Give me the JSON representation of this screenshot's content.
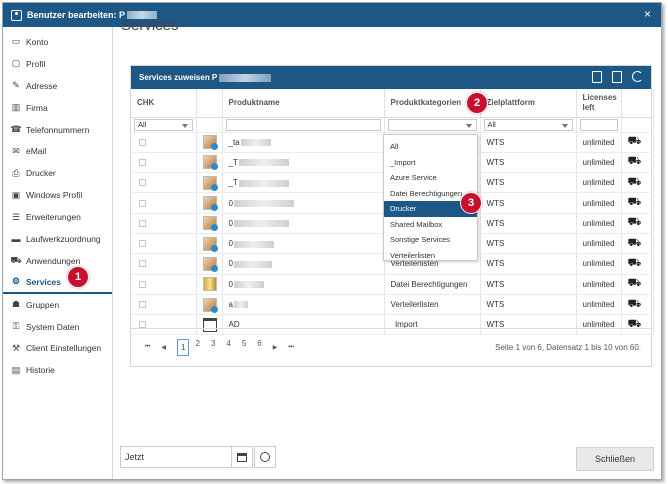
{
  "window": {
    "title": "Benutzer bearbeiten: P",
    "close_glyph": "×"
  },
  "sidebar": {
    "items": [
      {
        "label": "Konto",
        "icon": "card-icon"
      },
      {
        "label": "Profil",
        "icon": "profile-icon"
      },
      {
        "label": "Adresse",
        "icon": "edit-icon"
      },
      {
        "label": "Firma",
        "icon": "building-icon"
      },
      {
        "label": "Telefonnummern",
        "icon": "phone-icon"
      },
      {
        "label": "eMail",
        "icon": "mail-icon"
      },
      {
        "label": "Drucker",
        "icon": "printer-icon"
      },
      {
        "label": "Windows Profil",
        "icon": "window-icon"
      },
      {
        "label": "Erweiterungen",
        "icon": "list-icon"
      },
      {
        "label": "Laufwerkzuordnung",
        "icon": "drive-icon"
      },
      {
        "label": "Anwendungen",
        "icon": "cart-icon"
      },
      {
        "label": "Services",
        "icon": "gear-icon"
      },
      {
        "label": "Gruppen",
        "icon": "group-icon"
      },
      {
        "label": "System Daten",
        "icon": "key-icon"
      },
      {
        "label": "Client Einstellungen",
        "icon": "wrench-icon"
      },
      {
        "label": "Historie",
        "icon": "history-icon"
      }
    ]
  },
  "main": {
    "title": "Services"
  },
  "panel": {
    "title": "Services zuweisen P",
    "columns": [
      "CHK",
      "",
      "Produktname",
      "Produktkategorien",
      "Zielplattform",
      "Licenses left",
      ""
    ],
    "filters": {
      "chk": "All",
      "platform": "All"
    },
    "rows": [
      {
        "name": "_ta",
        "category": "",
        "platform": "WTS",
        "licenses": "unlimited",
        "icon": "service"
      },
      {
        "name": "_T",
        "category": "",
        "platform": "WTS",
        "licenses": "unlimited",
        "icon": "service"
      },
      {
        "name": "_T",
        "category": "",
        "platform": "WTS",
        "licenses": "unlimited",
        "icon": "service"
      },
      {
        "name": "0",
        "category": "",
        "platform": "WTS",
        "licenses": "unlimited",
        "icon": "service"
      },
      {
        "name": "0",
        "category": "",
        "platform": "WTS",
        "licenses": "unlimited",
        "icon": "service"
      },
      {
        "name": "0",
        "category": "",
        "platform": "WTS",
        "licenses": "unlimited",
        "icon": "service"
      },
      {
        "name": "0",
        "category": "Verteilerlisten",
        "platform": "WTS",
        "licenses": "unlimited",
        "icon": "service"
      },
      {
        "name": "0",
        "category": "Datei Berechtigungen",
        "platform": "WTS",
        "licenses": "unlimited",
        "icon": "jar"
      },
      {
        "name": "a",
        "category": "Verteilerlisten",
        "platform": "WTS",
        "licenses": "unlimited",
        "icon": "service"
      },
      {
        "name": "AD",
        "category": "_Import",
        "platform": "WTS",
        "licenses": "unlimited",
        "icon": "window"
      }
    ],
    "dropdown": {
      "options": [
        "All",
        "_Import",
        "Azure Service",
        "Datei Berechtigungen",
        "Drucker",
        "Shared Mailbox",
        "Sonstige Services",
        "Verteilerlisten"
      ],
      "selected": "Drucker"
    },
    "pager": {
      "first": "⏮",
      "prev": "◀",
      "next": "▶",
      "last": "⏭",
      "pages": [
        "1",
        "2",
        "3",
        "4",
        "5",
        "6"
      ],
      "current": "1",
      "info": "Seite 1 von 6, Datensatz 1 bis 10 von 60."
    }
  },
  "callouts": [
    "1",
    "2",
    "3"
  ],
  "footer": {
    "date_value": "Jetzt",
    "close_label": "Schließen"
  }
}
